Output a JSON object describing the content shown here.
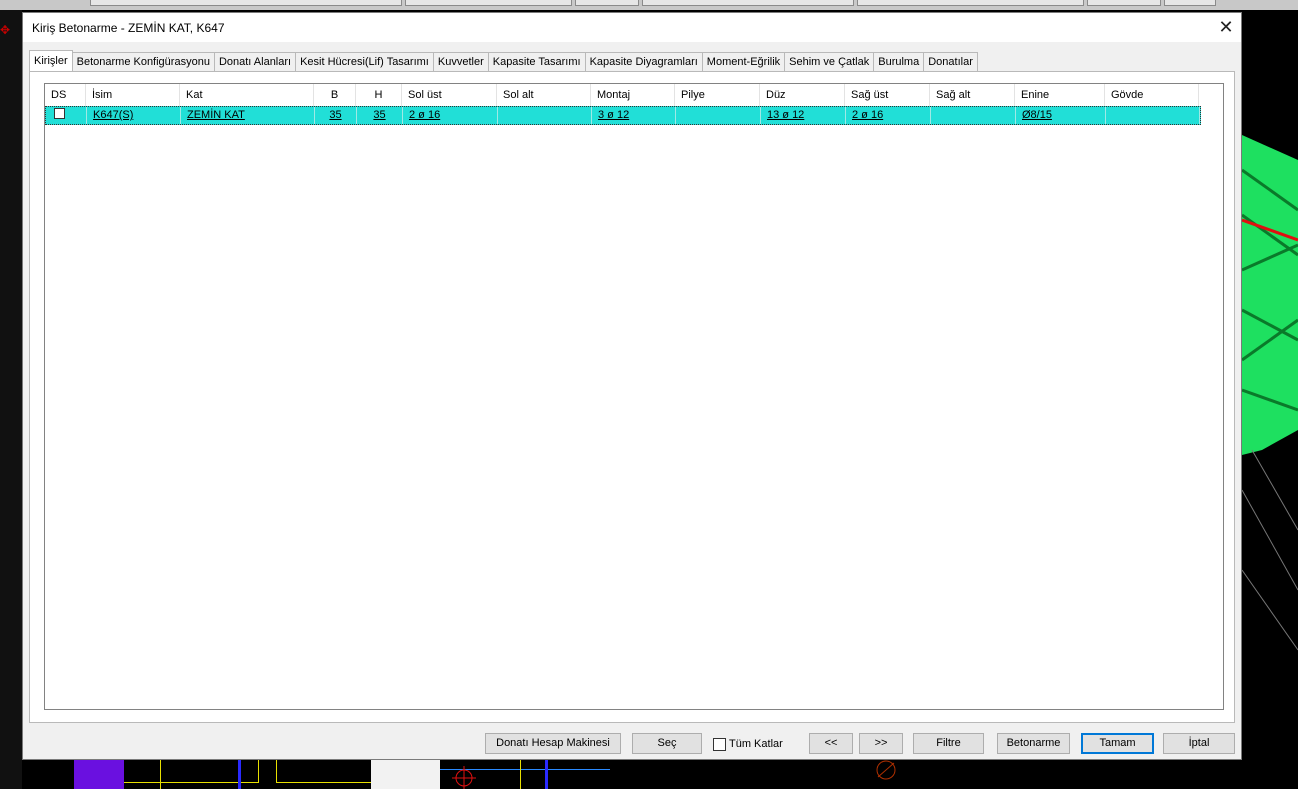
{
  "window": {
    "title": "Kiriş Betonarme - ZEMİN KAT, K647",
    "close_glyph": "✕"
  },
  "tabs": [
    {
      "label": "Kirişler",
      "active": true
    },
    {
      "label": "Betonarme Konfigürasyonu"
    },
    {
      "label": "Donatı Alanları"
    },
    {
      "label": "Kesit Hücresi(Lif) Tasarımı"
    },
    {
      "label": "Kuvvetler"
    },
    {
      "label": "Kapasite Tasarımı"
    },
    {
      "label": "Kapasite Diyagramları"
    },
    {
      "label": "Moment-Eğrilik"
    },
    {
      "label": "Sehim ve Çatlak"
    },
    {
      "label": "Burulma"
    },
    {
      "label": "Donatılar"
    }
  ],
  "table": {
    "columns": [
      "DS",
      "İsim",
      "Kat",
      "B",
      "H",
      "Sol üst",
      "Sol alt",
      "Montaj",
      "Pilye",
      "Düz",
      "Sağ üst",
      "Sağ alt",
      "Enine",
      "Gövde"
    ],
    "rows": [
      {
        "ds_checked": false,
        "cells": [
          "K647(S)",
          "ZEMİN KAT",
          "35",
          "35",
          "2 ø 16",
          "",
          "3 ø 12",
          "",
          "13 ø 12",
          "2 ø 16",
          "",
          "Ø8/15",
          ""
        ]
      }
    ]
  },
  "buttons": {
    "calculator": "Donatı Hesap Makinesi",
    "select": "Seç",
    "all_floors": "Tüm Katlar",
    "prev": "<<",
    "next": ">>",
    "filter": "Filtre",
    "reinforced_concrete": "Betonarme",
    "ok": "Tamam",
    "cancel": "İptal"
  },
  "bg_colors": {
    "selected_row": "#21dfd7",
    "model_green": "#1ee060"
  }
}
